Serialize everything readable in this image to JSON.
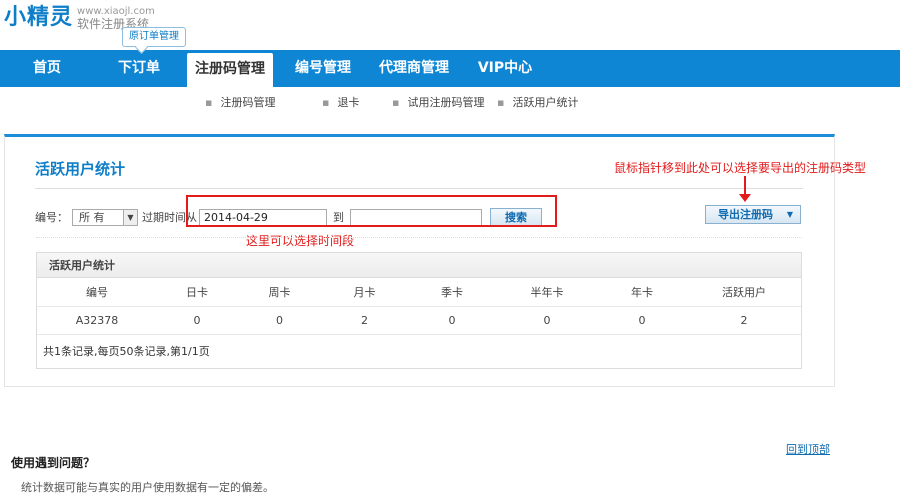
{
  "logo": {
    "main": "小精灵",
    "url": "www.xiaojl.com",
    "subtitle": "软件注册系统"
  },
  "tooltip": "原订单管理",
  "nav": [
    "首页",
    "下订单",
    "注册码管理",
    "编号管理",
    "代理商管理",
    "VIP中心"
  ],
  "subnav": [
    "注册码管理",
    "退卡",
    "试用注册码管理",
    "活跃用户统计"
  ],
  "panel": {
    "title": "活跃用户统计",
    "filter": {
      "number_label": "编号：",
      "select_value": "所 有",
      "expire_label": "过期时间从",
      "from_value": "2014-04-29",
      "to_label": "到",
      "to_value": "",
      "search_button": "搜索"
    },
    "export_button": "导出注册码",
    "note_time": "这里可以选择时间段",
    "note_export": "鼠标指针移到此处可以选择要导出的注册码类型",
    "table": {
      "title": "活跃用户统计",
      "columns": [
        "编号",
        "日卡",
        "周卡",
        "月卡",
        "季卡",
        "半年卡",
        "年卡",
        "活跃用户"
      ],
      "rows": [
        [
          "A32378",
          "0",
          "0",
          "2",
          "0",
          "0",
          "0",
          "2"
        ]
      ],
      "footer": "共1条记录,每页50条记录,第1/1页"
    }
  },
  "back_top": "回到顶部",
  "help": {
    "title": "使用遇到问题？",
    "text": "统计数据可能与真实的用户使用数据有一定的偏差。"
  },
  "colors": {
    "nav_blue": "#0e86d4",
    "accent_blue": "#0f7ec8",
    "annotation_red": "#e21b1b"
  }
}
